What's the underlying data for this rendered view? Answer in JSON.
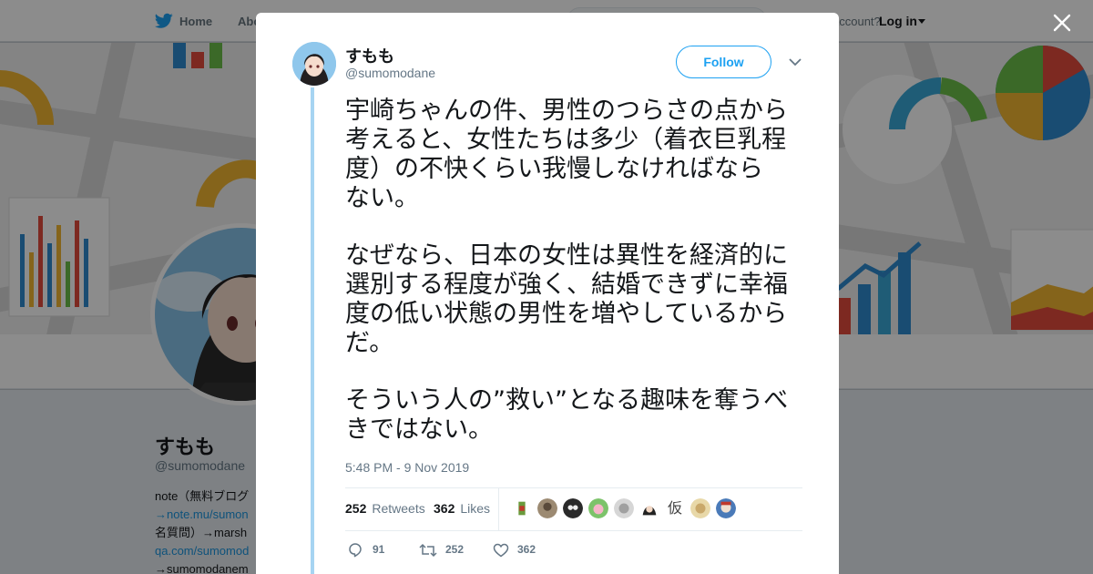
{
  "background": {
    "nav": {
      "home": "Home",
      "about": "Abo",
      "account_prompt": "account?",
      "login": "Log in"
    },
    "profile": {
      "name": "すもも",
      "handle": "@sumomodane",
      "bio_lines": [
        {
          "text": "note（無料ブログ",
          "link": false
        },
        {
          "text": "→note.mu/sumon",
          "link": true
        },
        {
          "text": "名質問）→marsh",
          "link": false
        },
        {
          "text": "qa.com/sumomod",
          "link": true
        },
        {
          "text": "→sumomodanem",
          "link": false
        }
      ]
    }
  },
  "tweet": {
    "author_name": "すもも",
    "author_handle": "@sumomodane",
    "follow_label": "Follow",
    "paragraphs": [
      "宇崎ちゃんの件、男性のつらさの点から\n考えると、女性たちは多少（着衣巨乳程\n度）の不快くらい我慢しなければなら\nない。",
      "なぜなら、日本の女性は異性を経済的に\n選別する程度が強く、結婚できずに幸福\n度の低い状態の男性を増やしているから\nだ。",
      "そういう人の”救い”となる趣味を奪うべ\nきではない。"
    ],
    "timestamp": "5:48 PM - 9 Nov 2019",
    "retweets_count": "252",
    "retweets_label": "Retweets",
    "likes_count": "362",
    "likes_label": "Likes",
    "liker_glyph": "仮",
    "replies": "91",
    "retweets_action": "252",
    "likes_action": "362"
  },
  "icons": [
    "twitter-bird-icon",
    "close-icon",
    "chevron-down-icon",
    "reply-icon",
    "retweet-icon",
    "heart-icon"
  ],
  "colors": {
    "accent": "#1da1f2",
    "thread_line": "#a6d4f2",
    "muted": "#657786",
    "text": "#14171a"
  }
}
